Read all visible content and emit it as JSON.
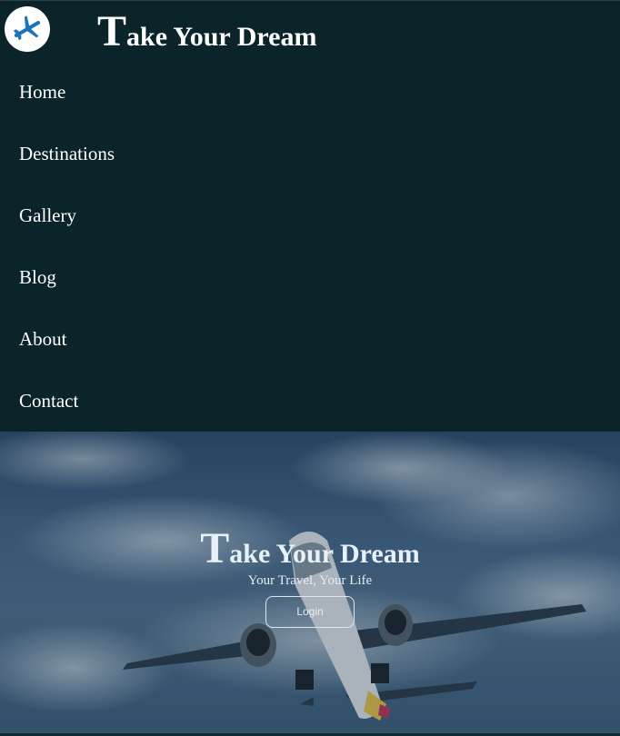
{
  "header": {
    "logo_icon": "airplane-icon",
    "brand_first_letter": "T",
    "brand_rest": "ake Your Dream"
  },
  "nav": {
    "items": [
      {
        "label": "Home"
      },
      {
        "label": "Destinations"
      },
      {
        "label": "Gallery"
      },
      {
        "label": "Blog"
      },
      {
        "label": "About"
      },
      {
        "label": "Contact"
      }
    ]
  },
  "hero": {
    "title_first_letter": "T",
    "title_rest": "ake Your Dream",
    "subtitle": "Your Travel, Your Life",
    "login_label": "Login"
  },
  "colors": {
    "header_bg": "#0a242a",
    "logo_bg": "#ffffff",
    "logo_icon": "#1d72b8",
    "text": "#ffffff"
  }
}
